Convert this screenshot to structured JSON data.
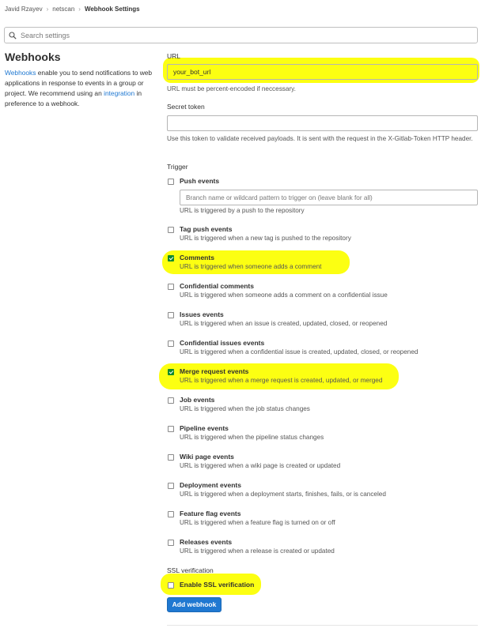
{
  "breadcrumb": {
    "items": [
      "Javid Rzayev",
      "netscan",
      "Webhook Settings"
    ]
  },
  "search": {
    "placeholder": "Search settings"
  },
  "section": {
    "title": "Webhooks",
    "desc_link": "Webhooks",
    "desc_1": " enable you to send notifications to web applications in response to events in a group or project. We recommend using an ",
    "desc_link2": "integration",
    "desc_2": " in preference to a webhook."
  },
  "url": {
    "label": "URL",
    "value": "your_bot_url",
    "help": "URL must be percent-encoded if neccessary."
  },
  "secret": {
    "label": "Secret token",
    "value": "",
    "help": "Use this token to validate received payloads. It is sent with the request in the X-Gitlab-Token HTTP header."
  },
  "trigger": {
    "label": "Trigger",
    "branch_placeholder": "Branch name or wildcard pattern to trigger on (leave blank for all)",
    "events": [
      {
        "name": "Push events",
        "desc": "URL is triggered by a push to the repository",
        "checked": false
      },
      {
        "name": "Tag push events",
        "desc": "URL is triggered when a new tag is pushed to the repository",
        "checked": false
      },
      {
        "name": "Comments",
        "desc": "URL is triggered when someone adds a comment",
        "checked": true
      },
      {
        "name": "Confidential comments",
        "desc": "URL is triggered when someone adds a comment on a confidential issue",
        "checked": false
      },
      {
        "name": "Issues events",
        "desc": "URL is triggered when an issue is created, updated, closed, or reopened",
        "checked": false
      },
      {
        "name": "Confidential issues events",
        "desc": "URL is triggered when a confidential issue is created, updated, closed, or reopened",
        "checked": false
      },
      {
        "name": "Merge request events",
        "desc": "URL is triggered when a merge request is created, updated, or merged",
        "checked": true
      },
      {
        "name": "Job events",
        "desc": "URL is triggered when the job status changes",
        "checked": false
      },
      {
        "name": "Pipeline events",
        "desc": "URL is triggered when the pipeline status changes",
        "checked": false
      },
      {
        "name": "Wiki page events",
        "desc": "URL is triggered when a wiki page is created or updated",
        "checked": false
      },
      {
        "name": "Deployment events",
        "desc": "URL is triggered when a deployment starts, finishes, fails, or is canceled",
        "checked": false
      },
      {
        "name": "Feature flag events",
        "desc": "URL is triggered when a feature flag is turned on or off",
        "checked": false
      },
      {
        "name": "Releases events",
        "desc": "URL is triggered when a release is created or updated",
        "checked": false
      }
    ]
  },
  "ssl": {
    "label": "SSL verification",
    "checkbox_label": "Enable SSL verification",
    "checked": false
  },
  "submit": {
    "label": "Add webhook"
  },
  "colors": {
    "highlight": "#fcff12",
    "link": "#1f78d1",
    "primary_button": "#1f78d1",
    "checkbox_checked": "#0f8a2e"
  },
  "icons": {
    "search": "search-icon",
    "breadcrumb_separator": "chevron-right-icon",
    "checkmark": "checkmark-icon"
  }
}
